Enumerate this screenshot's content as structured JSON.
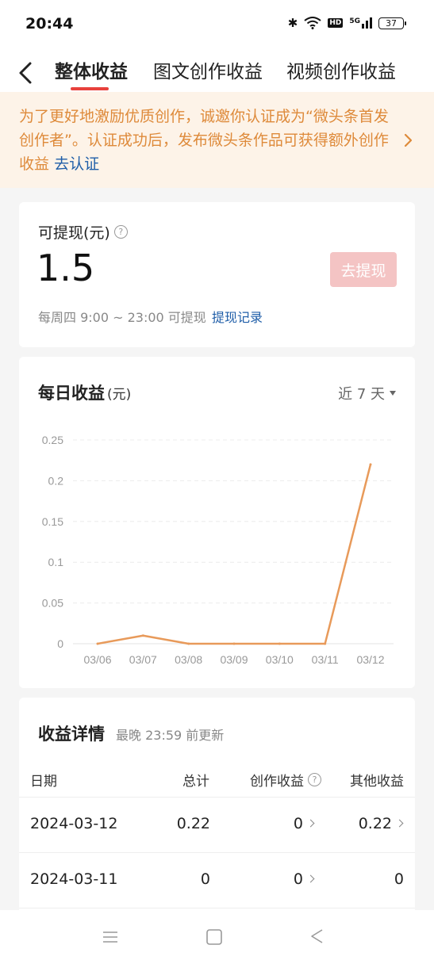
{
  "status": {
    "time": "20:44",
    "hd": "HD",
    "signal": "5G",
    "battery": "37"
  },
  "nav": {
    "tabs": [
      "整体收益",
      "图文创作收益",
      "视频创作收益"
    ],
    "active_index": 0
  },
  "notice": {
    "text": "为了更好地激励优质创作，诚邀你认证成为“微头条首发创作者”。认证成功后，发布微头条作品可获得额外创作收益",
    "link": "去认证"
  },
  "withdraw": {
    "label": "可提现(元)",
    "amount": "1.5",
    "button": "去提现",
    "note": "每周四 9:00 ~ 23:00 可提现",
    "record_link": "提现记录"
  },
  "daily": {
    "title": "每日收益",
    "unit": "(元)",
    "range": "近 7 天"
  },
  "chart_data": {
    "type": "line",
    "title": "每日收益",
    "categories": [
      "03/06",
      "03/07",
      "03/08",
      "03/09",
      "03/10",
      "03/11",
      "03/12"
    ],
    "values": [
      0,
      0.01,
      0,
      0,
      0,
      0,
      0.22
    ],
    "y_ticks": [
      "0",
      "0.05",
      "0.1",
      "0.15",
      "0.2",
      "0.25"
    ],
    "ylim": [
      0,
      0.25
    ],
    "grid": true,
    "line_color": "#e89a5a"
  },
  "details": {
    "title": "收益详情",
    "subtitle": "最晚 23:59 前更新",
    "headers": [
      "日期",
      "总计",
      "创作收益",
      "其他收益"
    ],
    "rows": [
      {
        "date": "2024-03-12",
        "total": "0.22",
        "creation": "0",
        "other": "0.22"
      },
      {
        "date": "2024-03-11",
        "total": "0",
        "creation": "0",
        "other": "0"
      }
    ]
  },
  "colors": {
    "accent": "#e8413c",
    "notice_bg": "#fdf3e8",
    "notice_text": "#de8a3a",
    "link": "#1f5ea8"
  }
}
